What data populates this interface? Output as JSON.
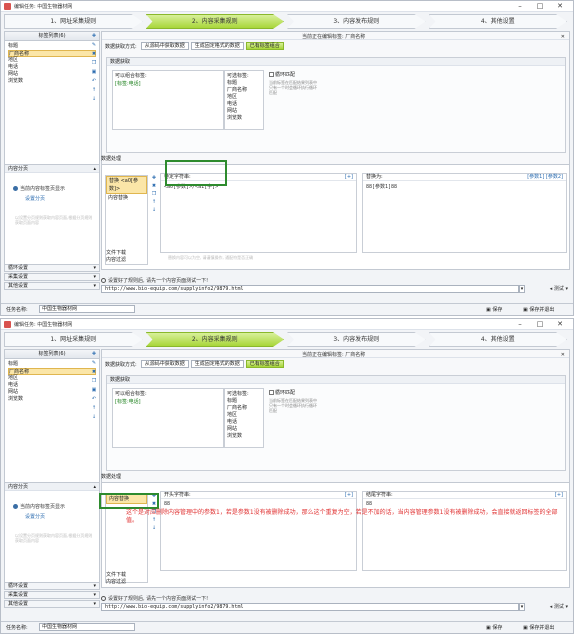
{
  "window": {
    "title": "编辑任务: 中国生物器材网",
    "min": "–",
    "max": "□",
    "close": "✕"
  },
  "steps": [
    "1、网址采集规则",
    "2、内容采集规则",
    "3、内容发布规则",
    "4、其他设置"
  ],
  "left_panel": {
    "title": "标签列表(6)",
    "items": [
      "标题",
      "厂商名称",
      "地区",
      "电话",
      "网站",
      "浏览数"
    ],
    "selected": "厂商名称"
  },
  "main": {
    "edit_label": "当前正在编辑标签: 厂商名称",
    "data_source_label": "数据获取方式:",
    "tabs": [
      "从源码中获取数据",
      "生成固定格式的数据",
      "已有标签组合"
    ],
    "group_title": "数据获取",
    "combine_label": "可以组合标签:",
    "combine_value": "[标签:电话]",
    "available_label": "可选标签:",
    "available": [
      "标题",
      "厂商名称",
      "地区",
      "电话",
      "网站",
      "浏览数"
    ],
    "loop_label": "循环匹配",
    "loop_hint": "当前标签在匹配结果列表中只有一个时会循环执行循环匹配"
  },
  "process": {
    "title": "数据处理",
    "list_header_1": "替换 <a0[参数]>",
    "list_item_1": "内容替换",
    "list_header_2": "内容替换",
    "left_title_1": "待定字符串:",
    "left_value_1": "<a0[参数]>/<a1[字]>",
    "left_title_2": "开头字符串:",
    "left_value_2": "88",
    "left_link": "[+]",
    "right_title_1": "替换为:",
    "right_value_1": "88[参数1]88",
    "right_title_2": "结尾字符串:",
    "right_value_2": "88",
    "right_links": "[参数1]  [参数2]",
    "warn": "替换内容可以为空, 请谨慎操作, 通配符是否正确",
    "tools": [
      "文件下载",
      "内容过滤"
    ]
  },
  "left_bottom": {
    "title": "内容分页",
    "info": "当前内容标签页显示",
    "link": "设置分页",
    "faint": "以设置分页规则获取内容页面,根据分页规则获取页面内容",
    "sections": [
      "循环设置",
      "采集设置",
      "其他设置"
    ]
  },
  "url": {
    "hint": "设置好了规则后, 请先一个内容页面测试一下!",
    "value": "http://www.bio-equip.com/supplyinfo2/9879.html",
    "test": "测试"
  },
  "footer": {
    "task_label": "任务名称:",
    "task_value": "中国生物器材网",
    "save": "保存",
    "save_exit": "保存并退出"
  },
  "annotation": {
    "text": "这个是对应删除内容管理中的参数1，若是参数1没有被删除成功，那么这个重复为空，若是不加的话，当内容管理参数1没有被删除成功，会直接就返回标签的全部值。"
  }
}
